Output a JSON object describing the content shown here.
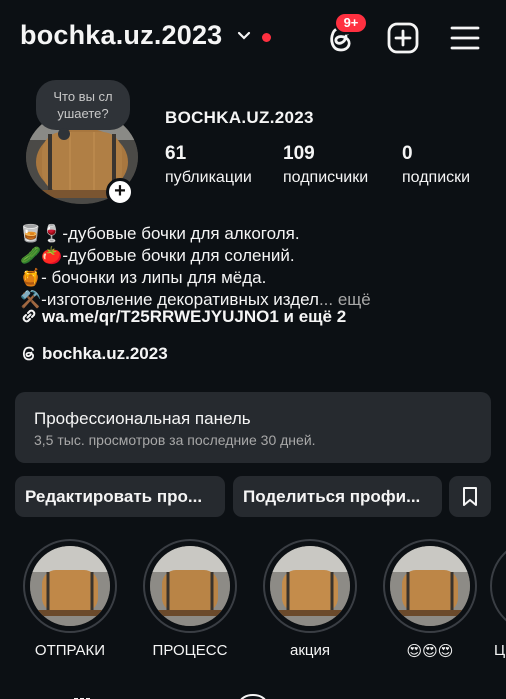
{
  "header": {
    "username": "bochka.uz.2023",
    "notification_badge": "9+",
    "icons": [
      "chevron-down-icon",
      "threads-icon",
      "add-square-icon",
      "menu-icon"
    ],
    "accent": "#ff3040"
  },
  "profile": {
    "note": "Что вы сл ушаете?",
    "display_name": "BOCHKA.UZ.2023",
    "stats": [
      {
        "value": "61",
        "label": "публикации"
      },
      {
        "value": "109",
        "label": "подписчики"
      },
      {
        "value": "0",
        "label": "подписки"
      }
    ]
  },
  "bio": {
    "lines": [
      "🥃🍷-дубовые бочки для алкоголя.",
      "🥒🍅-дубовые бочки для солений.",
      "🍯- бочонки из липы для мёда.",
      "⚒️-изготовление декоративных издел"
    ],
    "more": "... ещё",
    "link": "wa.me/qr/T25RRWEJYUJNO1 и ещё 2",
    "threads_handle": "bochka.uz.2023"
  },
  "pro_panel": {
    "title": "Профессиональная панель",
    "subtitle": "3,5 тыс. просмотров за последние 30 дней."
  },
  "buttons": {
    "edit": "Редактировать про...",
    "share": "Поделиться профи..."
  },
  "highlights": [
    {
      "label": "ОТПРАКИ"
    },
    {
      "label": "ПРОЦЕСС"
    },
    {
      "label": "акция"
    },
    {
      "label": "😍😍😍"
    },
    {
      "label": "Ц"
    }
  ]
}
